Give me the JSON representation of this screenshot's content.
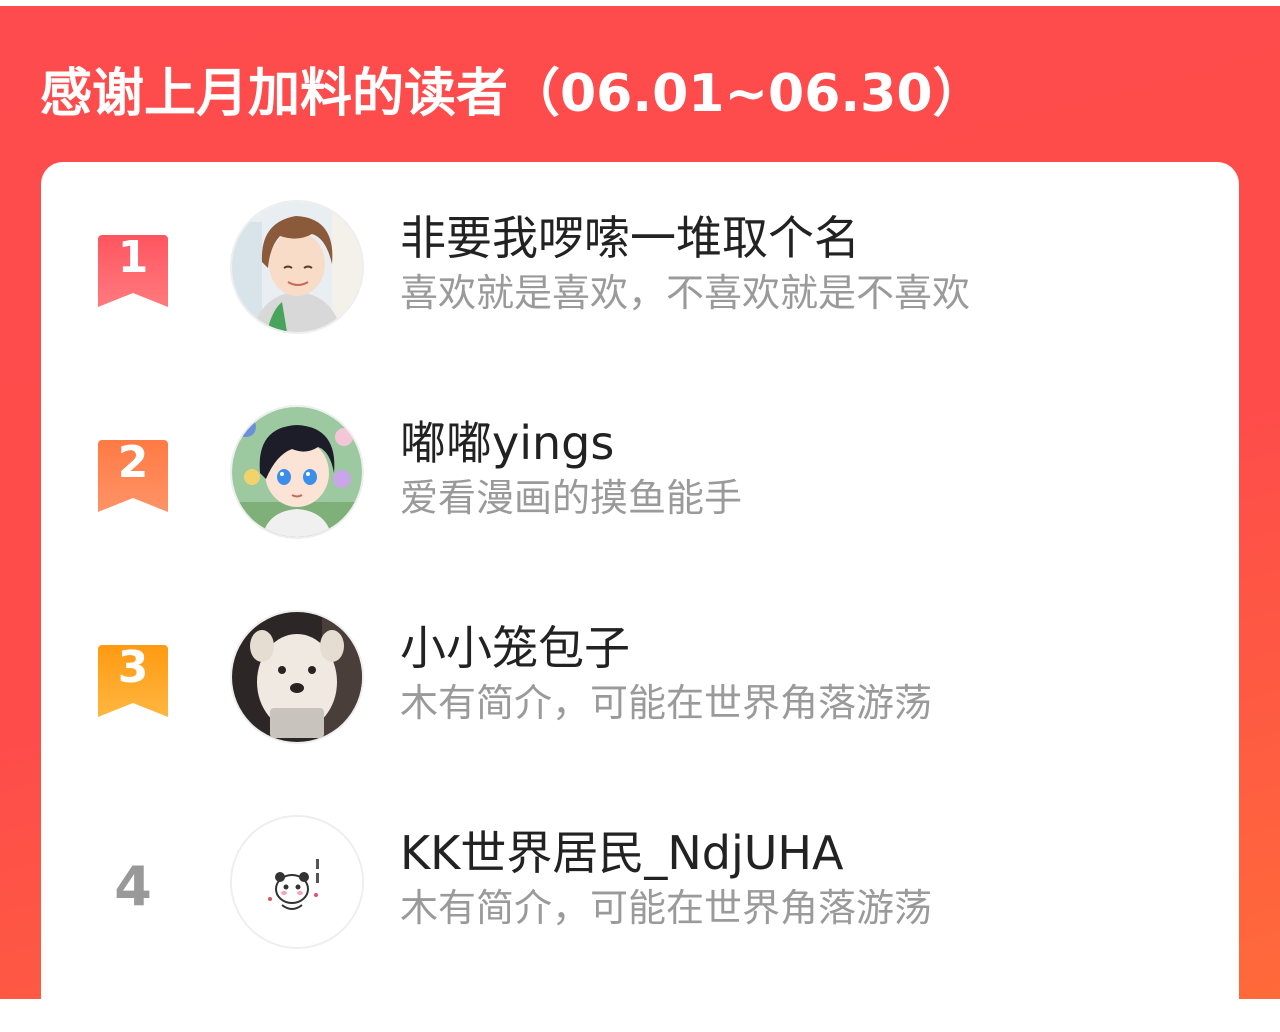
{
  "title": "感谢上月加料的读者（06.01~06.30）",
  "colors": {
    "banner": "#fe4b4d",
    "rank_1": "#fe6468",
    "rank_2": "#ff8552",
    "rank_3": "#ffa620",
    "rank_plain": "#999999"
  },
  "readers": [
    {
      "rank": "1",
      "name": "非要我啰嗦一堆取个名",
      "bio": "喜欢就是喜欢，不喜欢就是不喜欢",
      "avatar": "anime-boy-brown-hair-avatar"
    },
    {
      "rank": "2",
      "name": "嘟嘟yings",
      "bio": "爱看漫画的摸鱼能手",
      "avatar": "anime-boy-blue-eyes-avatar"
    },
    {
      "rank": "3",
      "name": "小小笼包子",
      "bio": "木有简介，可能在世界角落游荡",
      "avatar": "white-dog-avatar"
    },
    {
      "rank": "4",
      "name": "KK世界居民_NdjUHA",
      "bio": "木有简介，可能在世界角落游荡",
      "avatar": "panda-sticker-avatar"
    }
  ]
}
